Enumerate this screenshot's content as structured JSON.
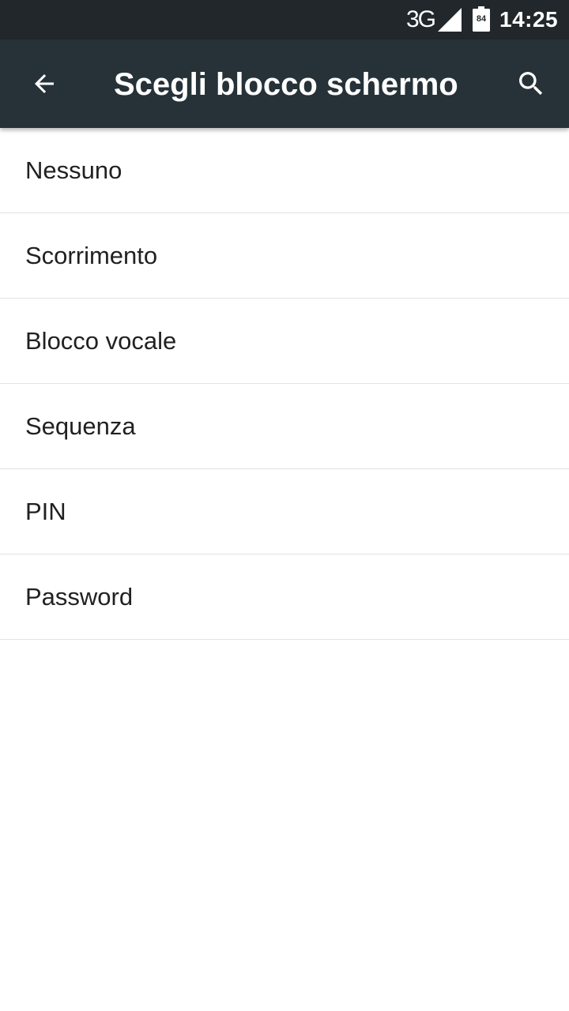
{
  "status_bar": {
    "network": "3G",
    "battery_level": "84",
    "time": "14:25",
    "signal_icon": "signal-full-icon",
    "battery_icon": "battery-icon"
  },
  "toolbar": {
    "title": "Scegli blocco schermo",
    "back_icon": "arrow-back-icon",
    "search_icon": "search-icon",
    "background": "#263238"
  },
  "list": {
    "items": [
      {
        "label": "Nessuno"
      },
      {
        "label": "Scorrimento"
      },
      {
        "label": "Blocco vocale"
      },
      {
        "label": "Sequenza"
      },
      {
        "label": "PIN"
      },
      {
        "label": "Password"
      }
    ]
  }
}
